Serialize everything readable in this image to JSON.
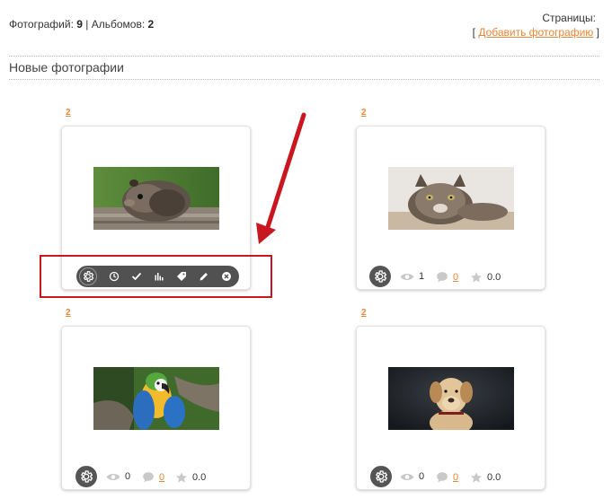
{
  "header": {
    "photos_label": "Фотографий:",
    "photos_count": "9",
    "separator": "|",
    "albums_label": "Альбомов:",
    "albums_count": "2",
    "pages_label": "Страницы:",
    "add_bracket_open": "[",
    "add_photo_link": "Добавить фотографию",
    "add_bracket_close": "]"
  },
  "section_title": "Новые фотографии",
  "colors": {
    "accent": "#e98537",
    "annotation": "#c8171e",
    "toolbar_bg": "#515151"
  },
  "toolbar_icons": [
    "settings-icon",
    "clock-icon",
    "check-icon",
    "stats-icon",
    "tag-icon",
    "edit-icon",
    "close-icon"
  ],
  "photos": [
    {
      "album_num": "2",
      "subject": "guinea-pig",
      "toolbar_open": true
    },
    {
      "album_num": "2",
      "subject": "cat",
      "views": "1",
      "comments": "0",
      "rating": "0.0"
    },
    {
      "album_num": "2",
      "subject": "parrot",
      "views": "0",
      "comments": "0",
      "rating": "0.0"
    },
    {
      "album_num": "2",
      "subject": "dog",
      "views": "0",
      "comments": "0",
      "rating": "0.0"
    }
  ]
}
